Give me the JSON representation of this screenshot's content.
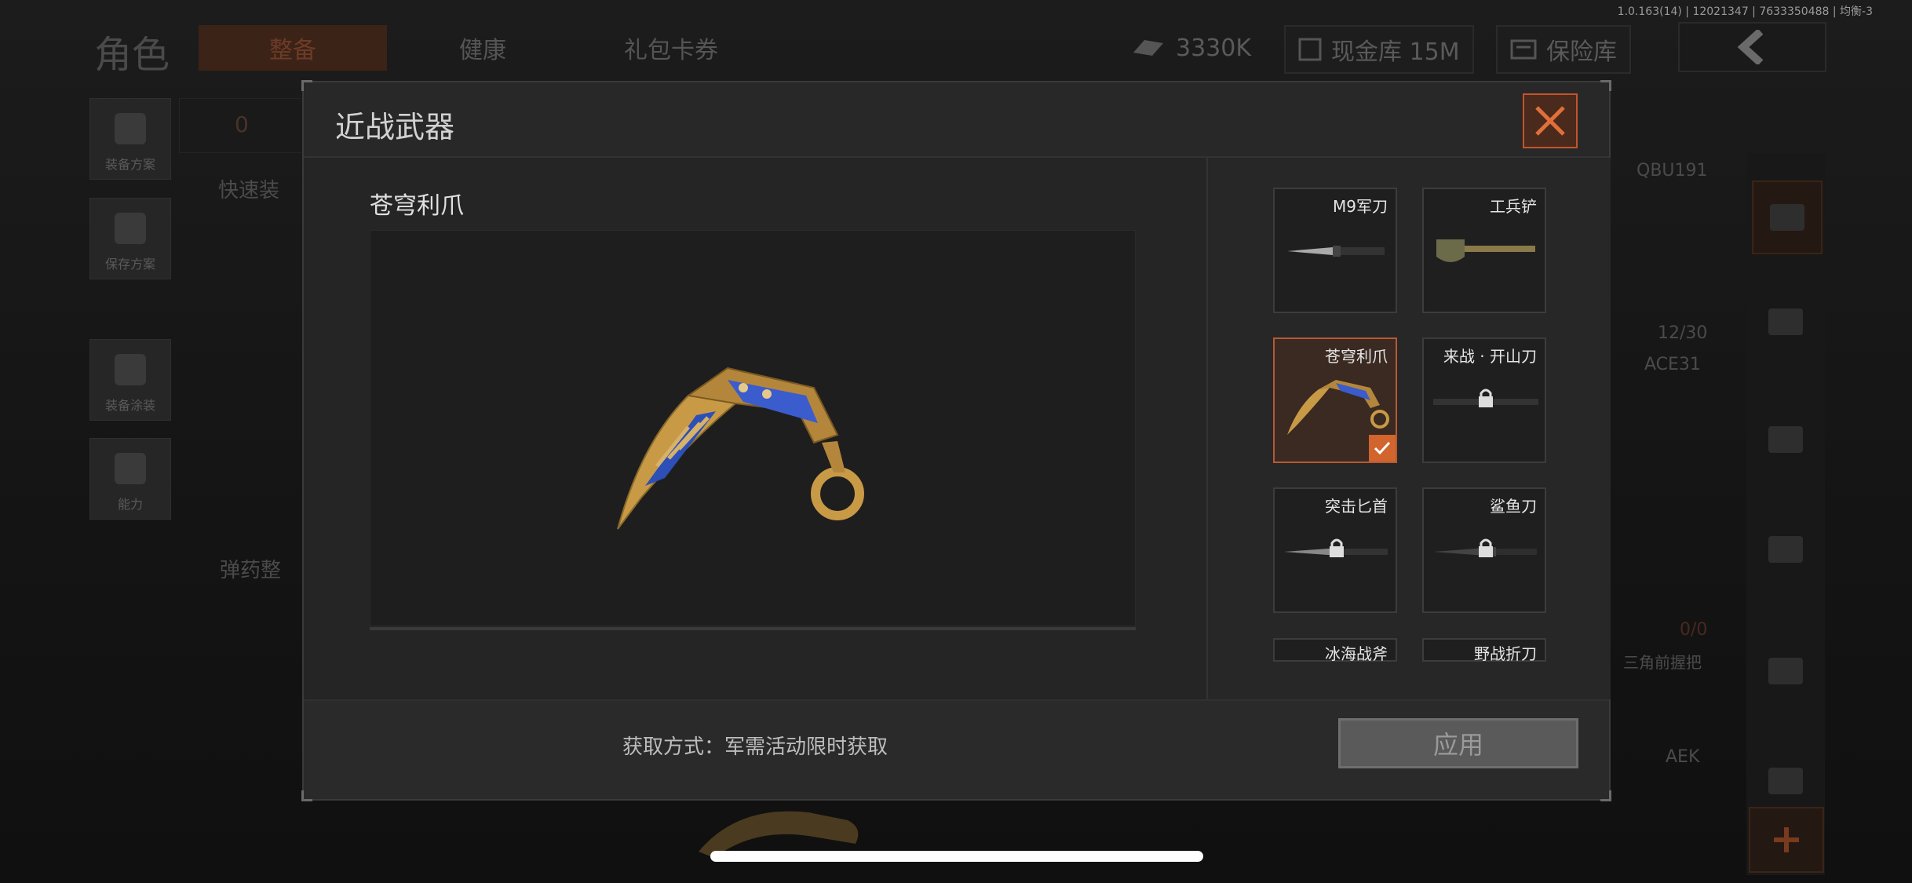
{
  "status": {
    "version": "1.0.163(14) | 12021347 | 7633350488 | 均衡-3"
  },
  "background": {
    "title": "角色",
    "tabs": [
      "整备",
      "健康",
      "礼包卡券"
    ],
    "currency": {
      "value": "3330K",
      "vault_label": "现金库 15M",
      "safe_label": "保险库"
    },
    "left_menu": [
      "装备方案",
      "保存方案",
      "装备涂装",
      "能力"
    ],
    "armor_count": "0",
    "quick_equip": "快速装",
    "ammo_label": "弹药整",
    "right_panel": {
      "weapon1": "QBU191",
      "ammo": "12/30",
      "weapon2": "ACE31",
      "ammo2": "0/0",
      "attachment": "三角前握把",
      "weapon3": "AEK"
    }
  },
  "modal": {
    "title": "近战武器",
    "selected_weapon_name": "苍穹利爪",
    "acquire_text": "获取方式：军需活动限时获取",
    "apply_label": "应用",
    "items": [
      {
        "label": "M9军刀",
        "locked": false,
        "selected": false,
        "icon": "bayonet-icon"
      },
      {
        "label": "工兵铲",
        "locked": false,
        "selected": false,
        "icon": "shovel-icon"
      },
      {
        "label": "苍穹利爪",
        "locked": false,
        "selected": true,
        "icon": "karambit-icon"
      },
      {
        "label": "来战 · 开山刀",
        "locked": true,
        "selected": false,
        "icon": "machete-icon"
      },
      {
        "label": "突击匕首",
        "locked": true,
        "selected": false,
        "icon": "dagger-icon"
      },
      {
        "label": "鲨鱼刀",
        "locked": true,
        "selected": false,
        "icon": "shark-knife-icon"
      },
      {
        "label": "冰海战斧",
        "locked": true,
        "selected": false,
        "icon": "axe-icon"
      },
      {
        "label": "野战折刀",
        "locked": true,
        "selected": false,
        "icon": "folding-knife-icon"
      }
    ]
  },
  "colors": {
    "accent": "#d2642d",
    "selected_bg": "#3a2a22",
    "blade_blue": "#2c4fb8",
    "gold": "#c99a46"
  }
}
